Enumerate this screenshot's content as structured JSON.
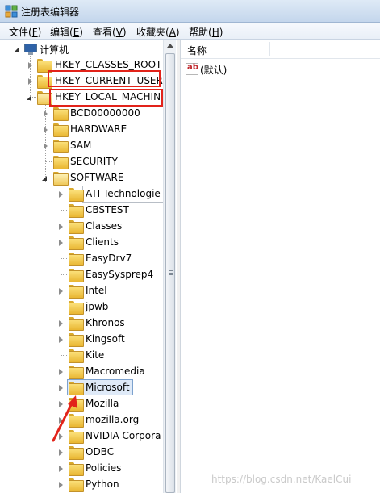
{
  "window": {
    "title": "注册表编辑器"
  },
  "menu": [
    {
      "label": "文件(",
      "accel": "F",
      "close": ")"
    },
    {
      "label": "编辑(",
      "accel": "E",
      "close": ")"
    },
    {
      "label": "查看(",
      "accel": "V",
      "close": ")"
    },
    {
      "label": "收藏夹(",
      "accel": "A",
      "close": ")"
    },
    {
      "label": "帮助(",
      "accel": "H",
      "close": ")"
    }
  ],
  "tree": {
    "root": "计算机",
    "hives": [
      {
        "label": "HKEY_CLASSES_ROOT",
        "state": "collapsed"
      },
      {
        "label": "HKEY_CURRENT_USER",
        "state": "collapsed"
      },
      {
        "label": "HKEY_LOCAL_MACHINE",
        "state": "expanded"
      }
    ],
    "hklm_children": [
      {
        "label": "BCD00000000",
        "state": "collapsed"
      },
      {
        "label": "HARDWARE",
        "state": "collapsed"
      },
      {
        "label": "SAM",
        "state": "collapsed"
      },
      {
        "label": "SECURITY",
        "state": "none"
      },
      {
        "label": "SOFTWARE",
        "state": "expanded"
      }
    ],
    "software_children": [
      {
        "label": "ATI Technologie",
        "state": "collapsed"
      },
      {
        "label": "CBSTEST",
        "state": "none"
      },
      {
        "label": "Classes",
        "state": "collapsed"
      },
      {
        "label": "Clients",
        "state": "collapsed"
      },
      {
        "label": "EasyDrv7",
        "state": "none"
      },
      {
        "label": "EasySysprep4",
        "state": "none"
      },
      {
        "label": "Intel",
        "state": "collapsed"
      },
      {
        "label": "jpwb",
        "state": "none"
      },
      {
        "label": "Khronos",
        "state": "collapsed"
      },
      {
        "label": "Kingsoft",
        "state": "collapsed"
      },
      {
        "label": "Kite",
        "state": "none"
      },
      {
        "label": "Macromedia",
        "state": "collapsed"
      },
      {
        "label": "Microsoft",
        "state": "collapsed",
        "selected": true
      },
      {
        "label": "Mozilla",
        "state": "collapsed"
      },
      {
        "label": "mozilla.org",
        "state": "collapsed"
      },
      {
        "label": "NVIDIA Corpora",
        "state": "collapsed"
      },
      {
        "label": "ODBC",
        "state": "collapsed"
      },
      {
        "label": "Policies",
        "state": "collapsed"
      },
      {
        "label": "Python",
        "state": "collapsed"
      }
    ]
  },
  "values_pane": {
    "column_name": "名称",
    "rows": [
      {
        "icon": "string-value-icon",
        "icon_text": "ab",
        "name": "(默认)"
      }
    ]
  },
  "annotations": {
    "highlight_color": "#e2231a"
  },
  "watermark": "https://blog.csdn.net/KaelCui"
}
